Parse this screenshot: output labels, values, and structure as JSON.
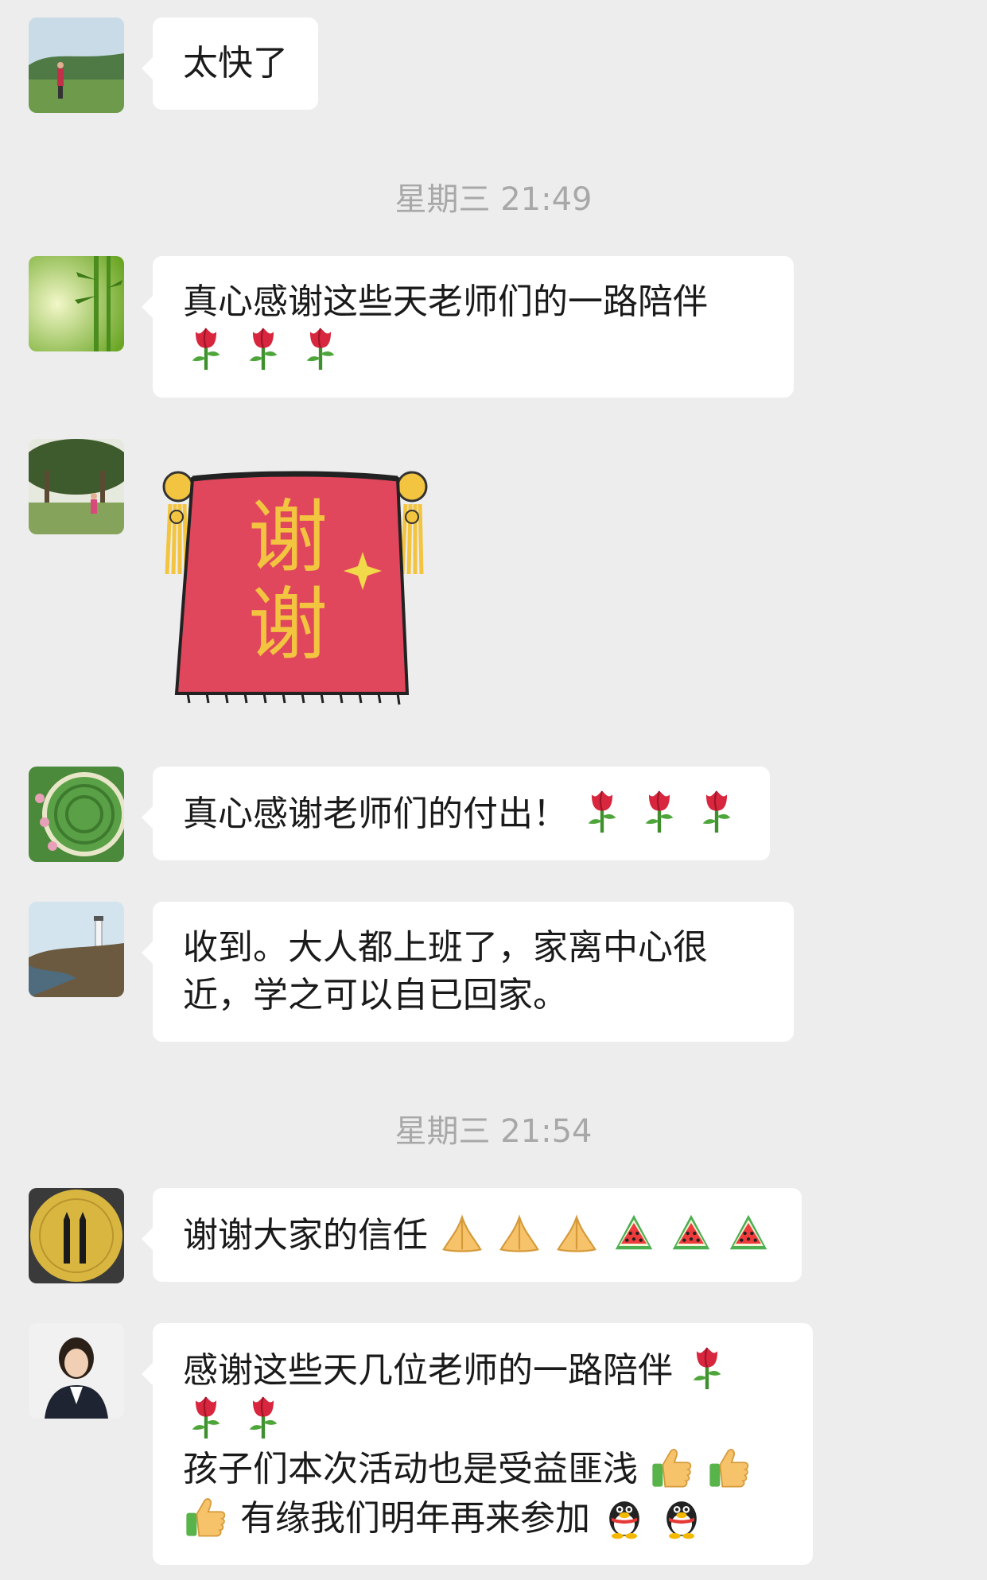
{
  "messages": [
    {
      "text": "太快了"
    },
    {
      "lines": [
        "真心感谢这些天老师们的一路陪伴"
      ]
    },
    {
      "sticker_text": [
        "谢",
        "谢"
      ]
    },
    {
      "text": "真心感谢老师们的付出！"
    },
    {
      "lines": [
        "收到。大人都上班了，家离中心很",
        "近，学之可以自已回家。"
      ]
    },
    {
      "text": "谢谢大家的信任"
    },
    {
      "lines": [
        "感谢这些天几位老师的一路陪伴",
        "孩子们本次活动也是受益匪浅",
        "有缘我们明年再来参加"
      ]
    }
  ],
  "timestamps": [
    "星期三 21:49",
    "星期三 21:54"
  ],
  "icons": {
    "rose": "rose-emoji",
    "pray": "pray-emoji",
    "watermelon": "watermelon-emoji",
    "thumbs_up": "thumbs-up-emoji",
    "penguin": "penguin-emoji"
  },
  "colors": {
    "background": "#ededed",
    "bubble": "#ffffff",
    "timestamp": "#a8a8a8",
    "sticker_red": "#e0475c",
    "sticker_gold": "#f2c440"
  }
}
